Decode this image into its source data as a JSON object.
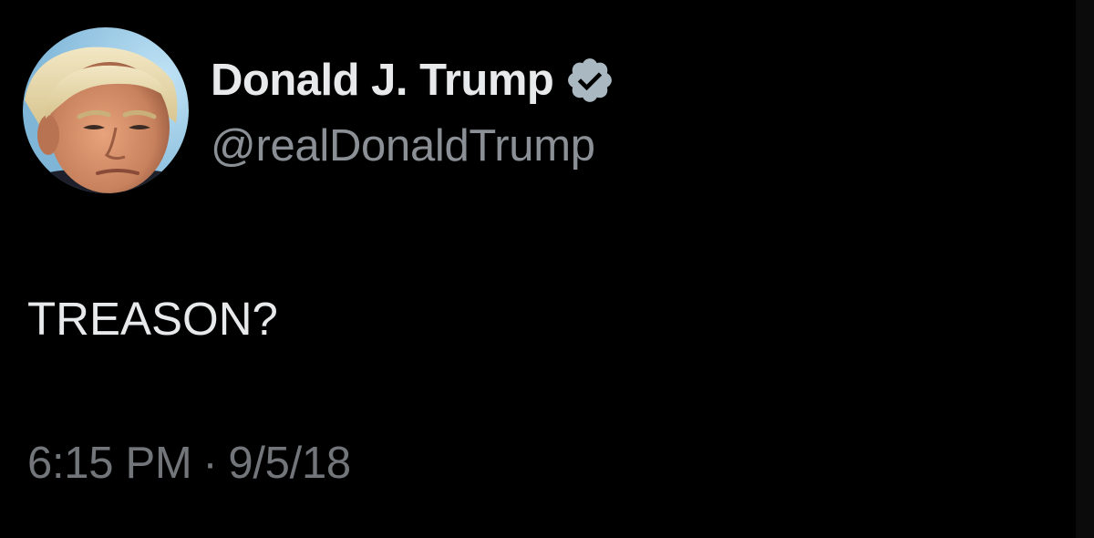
{
  "author": {
    "display_name": "Donald J. Trump",
    "handle": "@realDonaldTrump",
    "verified_icon": "verified-badge-icon",
    "avatar": "profile-photo"
  },
  "tweet": {
    "text": "TREASON?",
    "time": "6:15 PM",
    "separator": "·",
    "date": "9/5/18"
  },
  "colors": {
    "background": "#000000",
    "name": "#e7e9ea",
    "handle": "#8b9096",
    "timestamp": "#72767a",
    "verified_badge": "#aab8c2"
  }
}
